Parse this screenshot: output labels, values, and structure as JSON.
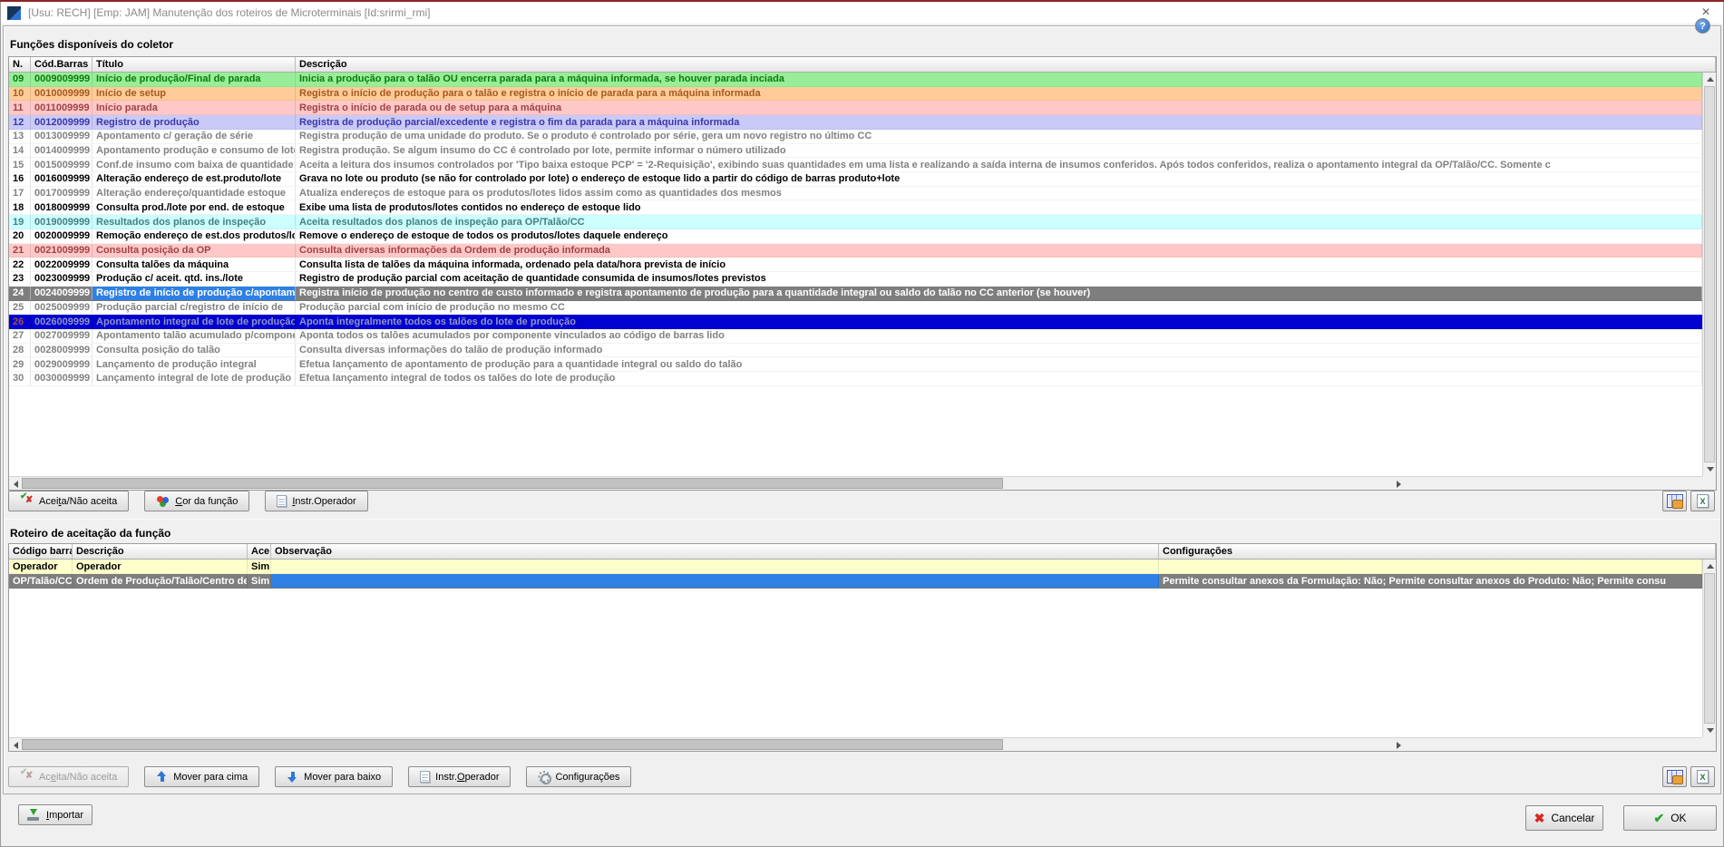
{
  "titlebar": {
    "title": "[Usu: RECH] [Emp: JAM] Manutenção dos roteiros de Microterminais [Id:srirmi_rmi]",
    "close_glyph": "×"
  },
  "help_glyph": "?",
  "colors": {
    "accent_top": "#8E2424",
    "row_green": "#98EE98",
    "row_orange": "#FFCC99",
    "row_pink": "#FFC8C8",
    "row_purple": "#CACAF8",
    "row_cyan": "#CCFFFF",
    "row_cream": "#FFFFCC",
    "focused_row_gray": "#7E7E7E",
    "focused_cell_blue": "#2E80E4",
    "multiselect_blue": "#0101D0"
  },
  "functions": {
    "caption": "Funções disponíveis do coletor",
    "columns": {
      "n": "N.",
      "barcode": "Cód.Barras",
      "title": "Título",
      "description": "Descrição"
    },
    "rows": [
      {
        "n": "09",
        "barcode": "0009009999",
        "title": "Início de produção/Final de parada",
        "description": "Inicia a produção para o talão OU encerra parada para a máquina informada, se houver parada inciada",
        "style": "green"
      },
      {
        "n": "10",
        "barcode": "0010009999",
        "title": "Início de setup",
        "description": "Registra o início de produção para o talão e registra o início de parada para a máquina informada",
        "style": "orange"
      },
      {
        "n": "11",
        "barcode": "0011009999",
        "title": "Início parada",
        "description": "Registra o início de parada ou de setup para a máquina",
        "style": "pink"
      },
      {
        "n": "12",
        "barcode": "0012009999",
        "title": "Registro de produção",
        "description": "Registra de produção parcial/excedente e registra o fim da parada para a máquina informada",
        "style": "purple"
      },
      {
        "n": "13",
        "barcode": "0013009999",
        "title": "Apontamento c/ geração de série",
        "description": "Registra produção de uma unidade do produto. Se o produto é controlado por série, gera um novo registro no último CC",
        "style": "gray"
      },
      {
        "n": "14",
        "barcode": "0014009999",
        "title": "Apontamento produção e consumo de lote",
        "description": "Registra produção. Se algum insumo do CC é controlado por lote, permite informar o número utilizado",
        "style": "gray"
      },
      {
        "n": "15",
        "barcode": "0015009999",
        "title": "Conf.de insumo com baixa de quantidade",
        "description": "Aceita a leitura dos insumos controlados por 'Tipo baixa estoque PCP' = '2-Requisição', exibindo suas quantidades em uma lista e realizando a saída interna de insumos conferidos. Após todos conferidos, realiza o apontamento integral da OP/Talão/CC. Somente c",
        "style": "gray"
      },
      {
        "n": "16",
        "barcode": "0016009999",
        "title": "Alteração endereço de est.produto/lote",
        "description": "Grava no lote ou produto (se não for controlado por lote) o endereço de estoque lido a partir do código de barras produto+lote",
        "style": "black"
      },
      {
        "n": "17",
        "barcode": "0017009999",
        "title": "Alteração endereço/quantidade estoque",
        "description": "Atualiza endereços de estoque para os produtos/lotes lidos assim como as quantidades dos mesmos",
        "style": "gray"
      },
      {
        "n": "18",
        "barcode": "0018009999",
        "title": "Consulta prod./lote por end. de estoque",
        "description": "Exibe uma lista de produtos/lotes contidos no endereço de estoque lido",
        "style": "black"
      },
      {
        "n": "19",
        "barcode": "0019009999",
        "title": "Resultados dos planos de inspeção",
        "description": "Aceita resultados dos planos de inspeção para OP/Talão/CC",
        "style": "cyan"
      },
      {
        "n": "20",
        "barcode": "0020009999",
        "title": "Remoção endereço de est.dos produtos/lot",
        "description": "Remove o endereço de estoque de todos os produtos/lotes daquele endereço",
        "style": "black"
      },
      {
        "n": "21",
        "barcode": "0021009999",
        "title": "Consulta posição da OP",
        "description": "Consulta diversas informações da Ordem de produção informada",
        "style": "pink"
      },
      {
        "n": "22",
        "barcode": "0022009999",
        "title": "Consulta talões da máquina",
        "description": "Consulta lista de talões da máquina informada, ordenado pela data/hora prevista de início",
        "style": "black"
      },
      {
        "n": "23",
        "barcode": "0023009999",
        "title": "Produção c/ aceit. qtd. ins./lote",
        "description": "Registro de produção parcial com aceitação de quantidade consumida de insumos/lotes previstos",
        "style": "black"
      },
      {
        "n": "24",
        "barcode": "0024009999",
        "title": "Registro de início de produção c/apontam",
        "description": "Registra início de produção no centro de custo informado e registra apontamento de produção para a quantidade integral ou saldo do talão no CC anterior (se houver)",
        "style": "focused",
        "focus": "title"
      },
      {
        "n": "25",
        "barcode": "0025009999",
        "title": "Produção parcial c/registro de início de",
        "description": "Produção parcial com início de produção no mesmo CC",
        "style": "gray"
      },
      {
        "n": "26",
        "barcode": "0026009999",
        "title": "Apontamento integral de lote de produção",
        "description": "Aponta integralmente todos os talões do lote de produção",
        "style": "bluesel"
      },
      {
        "n": "27",
        "barcode": "0027009999",
        "title": "Apontamento talão acumulado p/componente",
        "description": "Aponta todos os talões acumulados por componente vinculados ao código de barras lido",
        "style": "gray"
      },
      {
        "n": "28",
        "barcode": "0028009999",
        "title": "Consulta posição do talão",
        "description": "Consulta diversas informações do talão de produção informado",
        "style": "gray"
      },
      {
        "n": "29",
        "barcode": "0029009999",
        "title": "Lançamento de produção integral",
        "description": "Efetua lançamento de apontamento de produção para a quantidade integral ou saldo do talão",
        "style": "gray"
      },
      {
        "n": "30",
        "barcode": "0030009999",
        "title": "Lançamento integral de lote de produção",
        "description": "Efetua lançamento integral de todos os talões do lote de produção",
        "style": "gray"
      }
    ],
    "toolbar": [
      {
        "name": "accept-reject-button",
        "label": "Aceita/Não aceita",
        "u": 4,
        "icon": "accept-reject",
        "disabled": false
      },
      {
        "name": "function-color-button",
        "label": "Cor da função",
        "u": 0,
        "icon": "color",
        "disabled": false
      },
      {
        "name": "operator-instructions-button",
        "label": "Instr.Operador",
        "u": 0,
        "icon": "note",
        "disabled": false
      }
    ]
  },
  "roteiro": {
    "caption": "Roteiro de aceitação da função",
    "columns": {
      "barcode": "Código barras",
      "description": "Descrição",
      "ace": "Ace",
      "obs": "Observação",
      "config": "Configurações"
    },
    "rows": [
      {
        "barcode": "Operador",
        "description": "Operador",
        "ace": "Sim",
        "obs": "",
        "config": "",
        "style": "cream"
      },
      {
        "barcode": "OP/Talão/CC",
        "description": "Ordem de Produção/Talão/Centro de custo",
        "ace": "Sim",
        "obs": "",
        "config": "Permite consultar anexos da Formulação: Não; Permite consultar anexos do Produto: Não; Permite consu",
        "style": "selected2",
        "focus": "obs"
      }
    ],
    "toolbar": [
      {
        "name": "accept-reject-button",
        "label": "Aceita/Não aceita",
        "u": 2,
        "icon": "accept-reject",
        "disabled": true
      },
      {
        "name": "move-up-button",
        "label": "Mover para cima",
        "u": -1,
        "icon": "arrow-up",
        "disabled": false
      },
      {
        "name": "move-down-button",
        "label": "Mover para baixo",
        "u": -1,
        "icon": "arrow-down",
        "disabled": false
      },
      {
        "name": "operator-instructions-button",
        "label": "Instr.Operador",
        "u": 6,
        "icon": "note",
        "disabled": false
      },
      {
        "name": "configurations-button",
        "label": "Configurações",
        "u": 5,
        "icon": "gear",
        "disabled": false
      }
    ]
  },
  "footer": {
    "import": {
      "label": "Importar",
      "u": 0
    },
    "cancel": {
      "label": "Cancelar",
      "u": -1
    },
    "ok": {
      "label": "OK",
      "u": -1
    }
  }
}
